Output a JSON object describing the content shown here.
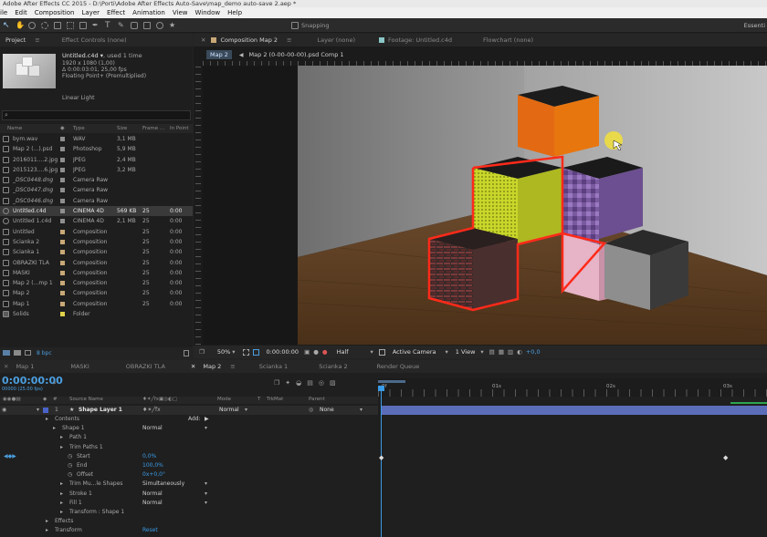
{
  "title": "Adobe After Effects CC 2015 - D:\\Porti\\Adobe After Effects Auto-Save\\map_demo auto-save 2.aep *",
  "menu": [
    "ile",
    "Edit",
    "Composition",
    "Layer",
    "Effect",
    "Animation",
    "View",
    "Window",
    "Help"
  ],
  "toolbar": {
    "snapping": "Snapping",
    "workspace": "Essenti"
  },
  "project_panel": {
    "tab_project": "Project",
    "tab_effect_controls": "Effect Controls (none)",
    "selected_name": "Untitled.c4d",
    "used": ", used 1 time",
    "info_lines": [
      "1920 x 1080 (1,00)",
      "Δ 0:00:03:01, 25,00 fps",
      "Floating Point+ (Premultiplied)"
    ],
    "linear_light": "Linear Light",
    "columns": [
      "Name",
      "Type",
      "Size",
      "Frame ...",
      "In Point"
    ],
    "bpc": "8 bpc",
    "items": [
      {
        "name": "bym.wav",
        "type": "WAV",
        "size": "3,1 MB",
        "frame": "",
        "in": "",
        "color": "#8f8f8f"
      },
      {
        "name": "Map 2 (...).psd",
        "type": "Photoshop",
        "size": "5,9 MB",
        "frame": "",
        "in": "",
        "color": "#8f8f8f"
      },
      {
        "name": "2016011....2.jpg",
        "type": "JPEG",
        "size": "2,4 MB",
        "frame": "",
        "in": "",
        "color": "#8f8f8f"
      },
      {
        "name": "2015123....6.jpg",
        "type": "JPEG",
        "size": "3,2 MB",
        "frame": "",
        "in": "",
        "color": "#8f8f8f"
      },
      {
        "name": "_DSC0448.dng",
        "type": "Camera Raw",
        "size": "",
        "frame": "",
        "in": "",
        "color": "#8f8f8f"
      },
      {
        "name": "_DSC0447.dng",
        "type": "Camera Raw",
        "size": "",
        "frame": "",
        "in": "",
        "color": "#8f8f8f"
      },
      {
        "name": "_DSC0446.dng",
        "type": "Camera Raw",
        "size": "",
        "frame": "",
        "in": "",
        "color": "#8f8f8f"
      },
      {
        "name": "Untitled.c4d",
        "type": "CINEMA 4D",
        "size": "569 KB",
        "frame": "25",
        "in": "0:00",
        "color": "#8f8f8f",
        "selected": true
      },
      {
        "name": "Untitled 1.c4d",
        "type": "CINEMA 4D",
        "size": "2,1 MB",
        "frame": "25",
        "in": "0:00",
        "color": "#8f8f8f"
      },
      {
        "name": "Untitled",
        "type": "Composition",
        "size": "",
        "frame": "25",
        "in": "0:00",
        "color": "#c9a877"
      },
      {
        "name": "Scianka 2",
        "type": "Composition",
        "size": "",
        "frame": "25",
        "in": "0:00",
        "color": "#c9a877"
      },
      {
        "name": "Scianka 1",
        "type": "Composition",
        "size": "",
        "frame": "25",
        "in": "0:00",
        "color": "#c9a877"
      },
      {
        "name": "OBRAZKI TLA",
        "type": "Composition",
        "size": "",
        "frame": "25",
        "in": "0:00",
        "color": "#c9a877"
      },
      {
        "name": "MASKI",
        "type": "Composition",
        "size": "",
        "frame": "25",
        "in": "0:00",
        "color": "#c9a877"
      },
      {
        "name": "Map 2 (...mp 1",
        "type": "Composition",
        "size": "",
        "frame": "25",
        "in": "0:00",
        "color": "#c9a877"
      },
      {
        "name": "Map 2",
        "type": "Composition",
        "size": "",
        "frame": "25",
        "in": "0:00",
        "color": "#c9a877"
      },
      {
        "name": "Map 1",
        "type": "Composition",
        "size": "",
        "frame": "25",
        "in": "0:00",
        "color": "#c9a877"
      },
      {
        "name": "Solids",
        "type": "Folder",
        "size": "",
        "frame": "",
        "in": "",
        "color": "#e0d24a"
      }
    ]
  },
  "comp_panel": {
    "tabs": [
      "Composition Map 2",
      "Layer (none)",
      "Footage: Untitled.c4d",
      "Flowchart (none)"
    ],
    "breadcrumb_tab": "Map 2",
    "breadcrumb": "Map 2 (0-00-00-00).psd Comp 1",
    "bottom": {
      "zoom": "50%",
      "time": "0:00:00:00",
      "resolution": "Half",
      "camera": "Active Camera",
      "view": "1 View",
      "exposure": "+0,0"
    }
  },
  "timeline": {
    "tabs": [
      "Map 1",
      "MASKI",
      "OBRAZKI TLA",
      "Map 2",
      "Scianka 1",
      "Scianka 2",
      "Render Queue"
    ],
    "current_time": "0:00:00:00",
    "fps": "00000 (25.00 fps)",
    "columns": {
      "source": "Source Name",
      "mode": "Mode",
      "t": "T",
      "trkmat": "TrkMat",
      "parent": "Parent"
    },
    "layer": {
      "index": "1",
      "name": "Shape Layer 1",
      "mode": "Normal",
      "parent": "None"
    },
    "props": [
      {
        "label": "Contents",
        "value": "Add:",
        "indent": 0
      },
      {
        "label": "Shape 1",
        "value": "Normal",
        "indent": 1
      },
      {
        "label": "Path 1",
        "value": "",
        "indent": 2
      },
      {
        "label": "Trim Paths 1",
        "value": "",
        "indent": 2
      },
      {
        "label": "Start",
        "value": "0,0%",
        "indent": 3
      },
      {
        "label": "End",
        "value": "100,0%",
        "indent": 3
      },
      {
        "label": "Offset",
        "value": "0x+0,0°",
        "indent": 3
      },
      {
        "label": "Trim Mu...le Shapes",
        "value": "Simultaneously",
        "indent": 2
      },
      {
        "label": "Stroke 1",
        "value": "Normal",
        "indent": 2
      },
      {
        "label": "Fill 1",
        "value": "Normal",
        "indent": 2
      },
      {
        "label": "Transform : Shape 1",
        "value": "",
        "indent": 2
      },
      {
        "label": "Effects",
        "value": "",
        "indent": 0
      },
      {
        "label": "Transform",
        "value": "Reset",
        "indent": 0
      }
    ],
    "ruler": [
      "0f",
      "01s",
      "02s",
      "03s"
    ]
  }
}
